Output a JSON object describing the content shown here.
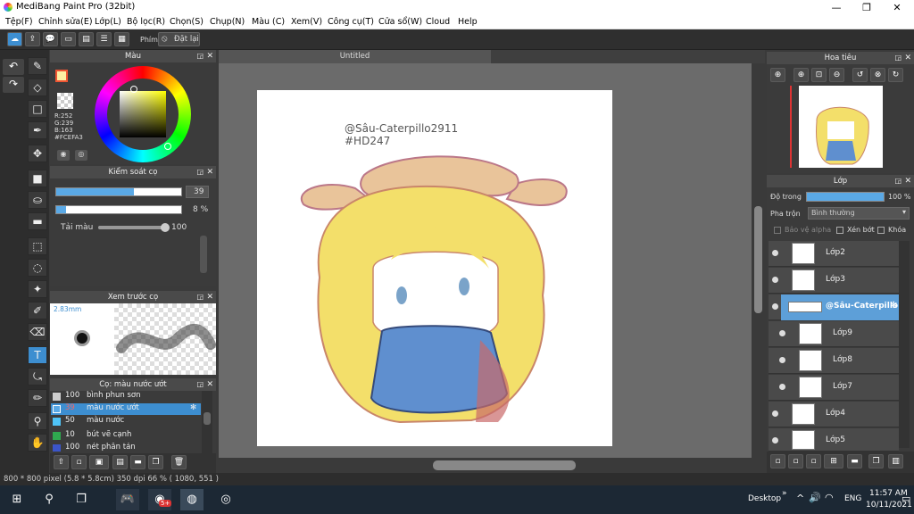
{
  "app": {
    "title": "MediBang Paint Pro (32bit)"
  },
  "menu": [
    "Tệp(F)",
    "Chỉnh sửa(E)",
    "Lớp(L)",
    "Bộ lọc(R)",
    "Chọn(S)",
    "Chụp(N)",
    "Màu (C)",
    "Xem(V)",
    "Công cụ(T)",
    "Cửa sổ(W)",
    "Cloud",
    "Help"
  ],
  "toolbar": {
    "phim_label": "Phím",
    "reset_label": "Đặt lại"
  },
  "color_panel": {
    "title": "Màu",
    "r": "R:252",
    "g": "G:239",
    "b": "B:163",
    "hex": "#FCEFA3",
    "primary": "#fcefa3",
    "secondary": "#ffffff"
  },
  "brush_control": {
    "title": "Kiểm soát cọ",
    "size_value": "39",
    "opacity_value": "8 %",
    "tai_mau_label": "Tải màu",
    "tai_mau_value": "100",
    "size_fraction": 0.62,
    "opacity_fraction": 0.08,
    "tai_mau_fraction": 1.0
  },
  "brush_preview": {
    "title": "Xem trước cọ",
    "size_label": "2.83mm"
  },
  "brush_list": {
    "title": "Cọ: màu nước ướt",
    "items": [
      {
        "size": "100",
        "name": "bình phun sơn",
        "color": "#cccccc"
      },
      {
        "size": "39",
        "name": "màu nước ướt",
        "color": "#5aa9e6"
      },
      {
        "size": "50",
        "name": "màu nước",
        "color": "#4fc3f7"
      },
      {
        "size": "10",
        "name": "bút vẽ cạnh",
        "color": "#2fa84f"
      },
      {
        "size": "100",
        "name": "nét phân tán",
        "color": "#3b55c9"
      }
    ]
  },
  "document": {
    "tab_title": "Untitled",
    "watermark_line1": "@Sâu-Caterpillo2911",
    "watermark_line2": "#HD247"
  },
  "navigator": {
    "title": "Hoa tiêu"
  },
  "layers_panel": {
    "title": "Lớp",
    "opacity_label": "Độ trong",
    "opacity_value": "100 %",
    "blend_label": "Pha trộn",
    "blend_value": "Bình thường",
    "protect_alpha": "Bảo vệ alpha",
    "clipping": "Xén bớt",
    "lock": "Khóa",
    "layers": [
      {
        "name": "Lớp2",
        "indent": 0,
        "selected": false
      },
      {
        "name": "Lớp3",
        "indent": 0,
        "selected": false
      },
      {
        "name": "@Sâu-Caterpillo",
        "indent": 1,
        "selected": true
      },
      {
        "name": "Lớp9",
        "indent": 1,
        "selected": false
      },
      {
        "name": "Lớp8",
        "indent": 1,
        "selected": false
      },
      {
        "name": "Lớp7",
        "indent": 1,
        "selected": false
      },
      {
        "name": "Lớp4",
        "indent": 0,
        "selected": false
      },
      {
        "name": "Lớp5",
        "indent": 0,
        "selected": false
      }
    ]
  },
  "status": {
    "text": "800 * 800 pixel   (5.8 * 5.8cm)   350 dpi   66 %   ( 1080, 551 )"
  },
  "taskbar": {
    "desktop_label": "Desktop",
    "lang": "ENG",
    "time": "11:57 AM",
    "date": "10/11/2021",
    "badge": "5+"
  },
  "colors": {
    "accent": "#5d9fd8",
    "panel": "#3b3b3b",
    "canvas_bg": "#6b6b6b"
  }
}
